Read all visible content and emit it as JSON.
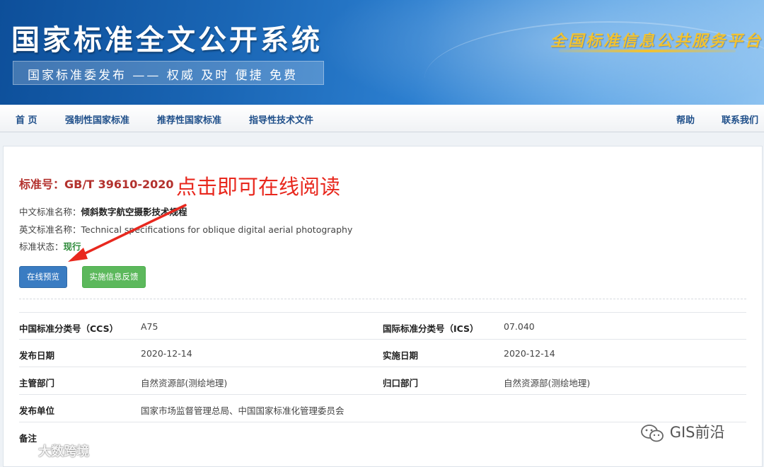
{
  "header": {
    "site_title": "国家标准全文公开系统",
    "slogan": "国家标准委发布 —— 权威 及时 便捷 免费",
    "platform_text": "全国标准信息公共服务平台",
    "banner_color": "#1a66b5",
    "platform_text_color": "#f2c230"
  },
  "nav": {
    "left_items": [
      "首 页",
      "强制性国家标准",
      "推荐性国家标准",
      "指导性技术文件"
    ],
    "right_items": [
      "帮助",
      "联系我们"
    ]
  },
  "standard": {
    "number": "标准号：GB/T 39610-2020",
    "cn_name_label": "中文标准名称：",
    "cn_name": "倾斜数字航空摄影技术规程",
    "en_name_label": "英文标准名称：",
    "en_name": "Technical specifications for oblique digital aerial photography",
    "status_label": "标准状态：",
    "status": "现行",
    "status_color": "#2e8b3a"
  },
  "annotation": {
    "text": "点击即可在线阅读",
    "color": "#e8281e"
  },
  "buttons": {
    "preview": "在线预览",
    "feedback": "实施信息反馈"
  },
  "meta": {
    "rows": [
      {
        "l_label": "中国标准分类号（CCS）",
        "l_value": "A75",
        "r_label": "国际标准分类号（ICS）",
        "r_value": "07.040"
      },
      {
        "l_label": "发布日期",
        "l_value": "2020-12-14",
        "r_label": "实施日期",
        "r_value": "2020-12-14"
      },
      {
        "l_label": "主管部门",
        "l_value": "自然资源部(测绘地理)",
        "r_label": "归口部门",
        "r_value": "自然资源部(测绘地理)"
      },
      {
        "l_label": "发布单位",
        "l_value": "国家市场监督管理总局、中国国家标准化管理委员会",
        "r_label": "",
        "r_value": ""
      },
      {
        "l_label": "备注",
        "l_value": "",
        "r_label": "",
        "r_value": ""
      }
    ]
  },
  "watermarks": {
    "left": "大数跨境",
    "right": "GIS前沿"
  }
}
